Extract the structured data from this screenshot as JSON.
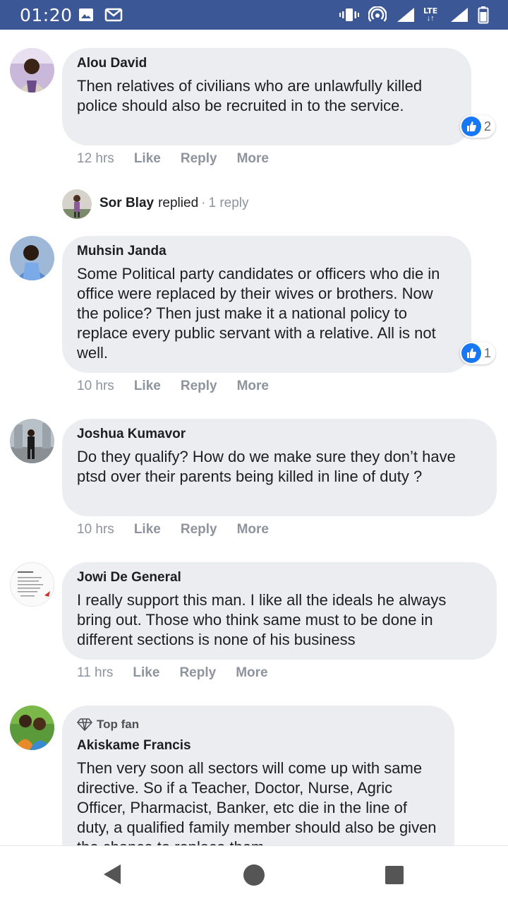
{
  "status_bar": {
    "time": "01:20",
    "network_label": "LTE",
    "icons": [
      "image-icon",
      "gmail-icon",
      "vibrate-icon",
      "hotspot-icon",
      "signal-icon",
      "signal-lte-icon",
      "battery-icon"
    ]
  },
  "comments": [
    {
      "author": "Alou David",
      "text": "Then relatives of civilians who are unlawfully killed police should also be recruited in to the service.",
      "time": "12 hrs",
      "like": "Like",
      "reply": "Reply",
      "more": "More",
      "reaction_count": "2"
    },
    {
      "author": "Muhsin Janda",
      "text": "Some Political party candidates or officers who die in office were replaced by their wives or brothers. Now the police? Then just make it a national policy to replace every public servant with a relative. All is not well.",
      "time": "10 hrs",
      "like": "Like",
      "reply": "Reply",
      "more": "More",
      "reaction_count": "1"
    },
    {
      "author": "Joshua Kumavor",
      "text": "Do they qualify? How do we make sure they don’t have ptsd over their parents being killed in line of duty ?",
      "time": "10 hrs",
      "like": "Like",
      "reply": "Reply",
      "more": "More"
    },
    {
      "author": "Jowi De General",
      "text": "I really support this man. I like all the ideals he always bring out. Those who think same must to be done in different sections is none of his business",
      "time": "11 hrs",
      "like": "Like",
      "reply": "Reply",
      "more": "More"
    },
    {
      "badge": "Top fan",
      "author": "Akiskame Francis",
      "text": "Then very soon all sectors will come up with same directive. So if a Teacher, Doctor, Nurse, Agric Officer, Pharmacist, Banker, etc die in the line of duty, a qualified family member should also be given the chance to replace them."
    }
  ],
  "reply_summary": {
    "name": "Sor Blay",
    "action": "replied",
    "separator": "·",
    "count": "1 reply"
  },
  "colors": {
    "status_bar": "#3b5795",
    "bubble": "#ebedf0",
    "meta_text": "#8d949e",
    "like_blue": "#1877f2"
  },
  "nav": {
    "icons": [
      "back-icon",
      "home-icon",
      "recents-icon"
    ]
  }
}
